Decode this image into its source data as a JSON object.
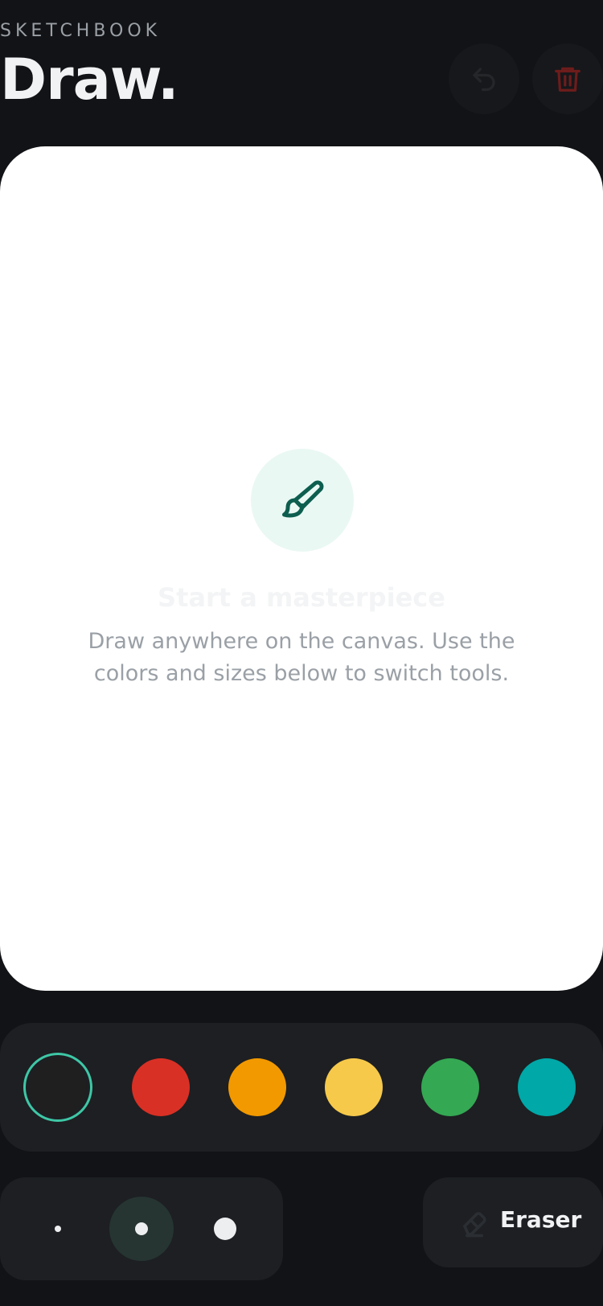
{
  "header": {
    "eyebrow": "SKETCHBOOK",
    "title": "Draw.",
    "undo_icon": "undo-icon",
    "trash_icon": "trash-icon"
  },
  "canvas": {
    "background": "#ffffff",
    "empty_state": {
      "icon": "paintbrush-icon",
      "title": "Start a masterpiece",
      "description": "Draw anywhere on the canvas. Use the colors and sizes below to switch tools."
    }
  },
  "palette": {
    "selected_index": 0,
    "colors": [
      "#1f1f1f",
      "#d93025",
      "#f29900",
      "#f6c94b",
      "#34a853",
      "#00a8a8"
    ]
  },
  "brush_sizes": {
    "selected_index": 1,
    "options": [
      "small",
      "medium",
      "large"
    ]
  },
  "eraser": {
    "label": "Eraser",
    "icon": "eraser-icon"
  },
  "accent": "#3ec7a6"
}
